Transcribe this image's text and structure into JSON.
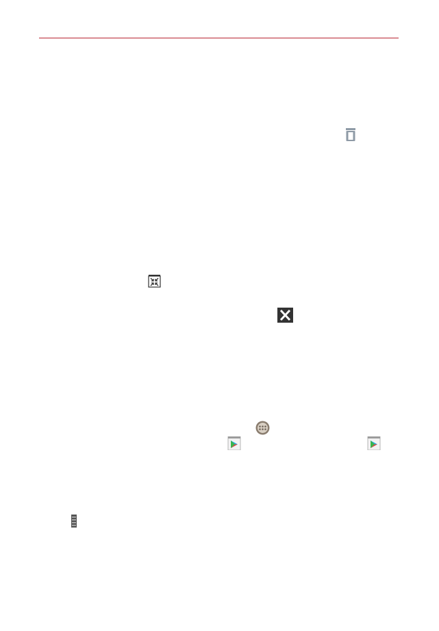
{
  "page": {
    "background": "#ffffff",
    "header_rule_color": "#b8232f"
  },
  "icons": {
    "trash": "trash-icon",
    "shrink": "shrink-icon",
    "close": "close-icon",
    "apps": "apps-icon",
    "play_store": "play-store-icon",
    "menu": "menu-icon"
  }
}
